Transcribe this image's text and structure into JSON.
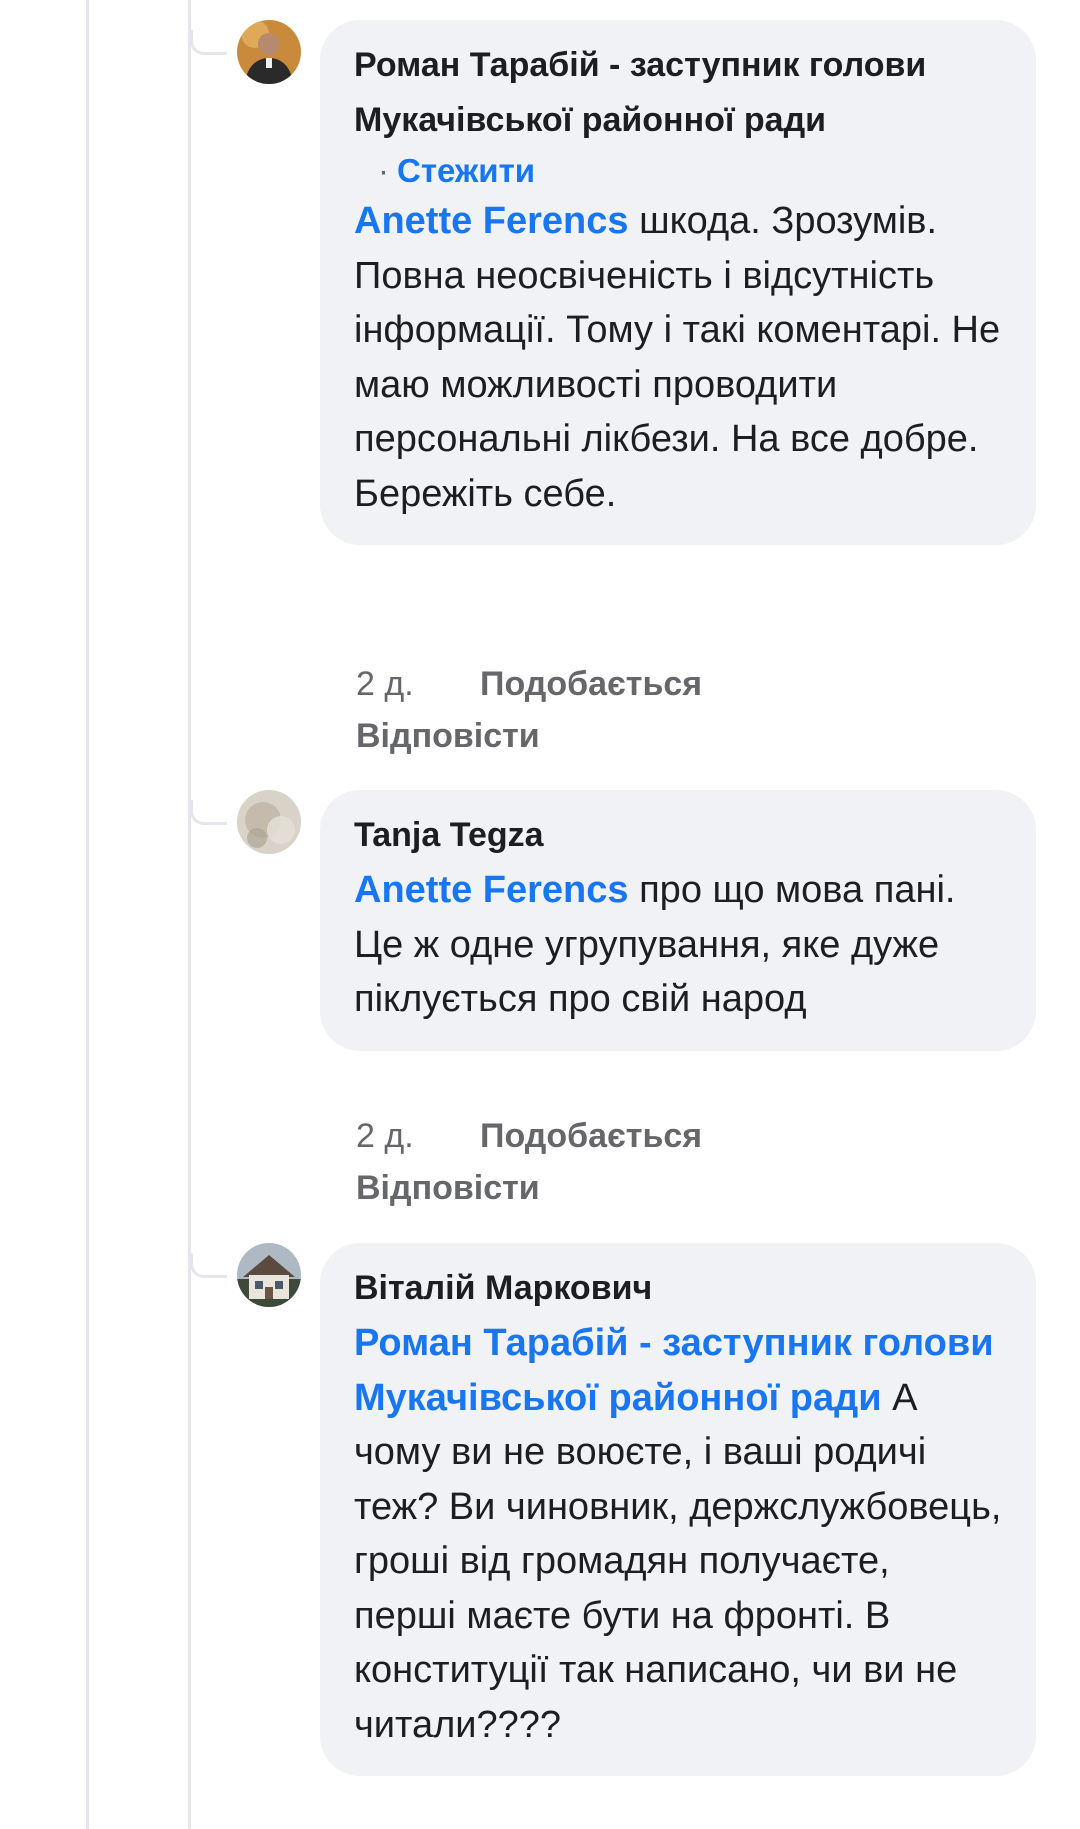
{
  "comments": [
    {
      "author": "Роман Тарабій - заступник голови Мукачівської районної ради",
      "follow_label": "Стежити",
      "mention": "Anette Ferencs",
      "text": " шкода. Зрозумів. Повна неосвіченість і відсутність інформації. Тому і такі коментарі. Не маю можливості проводити персональні лікбези. На все добре. Бережіть себе.",
      "time": "2 д.",
      "like_label": "Подобається",
      "reply_label": "Відповісти",
      "avatar_icon": "profile-photo-man"
    },
    {
      "author": "Tanja Tegza",
      "mention": "Anette Ferencs",
      "text": " про що мова пані. Це ж одне угрупування, яке дуже піклується про свій народ",
      "time": "2 д.",
      "like_label": "Подобається",
      "reply_label": "Відповісти",
      "avatar_icon": "profile-photo-blurred"
    },
    {
      "author": "Віталій Маркович",
      "mention": "Роман Тарабій - заступник голови Мукачівської районної ради",
      "text": " А чому ви не воюєте, і ваші родичі теж? Ви чиновник, держслужбовець, гроші від громадян получаєте, перші маєте бути на фронті. В конституції так написано, чи ви не читали????",
      "avatar_icon": "profile-photo-house"
    }
  ],
  "colors": {
    "link": "#1876f2",
    "bubble": "#f0f2f5",
    "meta": "#65676b",
    "thread_line": "#e4e6eb"
  }
}
